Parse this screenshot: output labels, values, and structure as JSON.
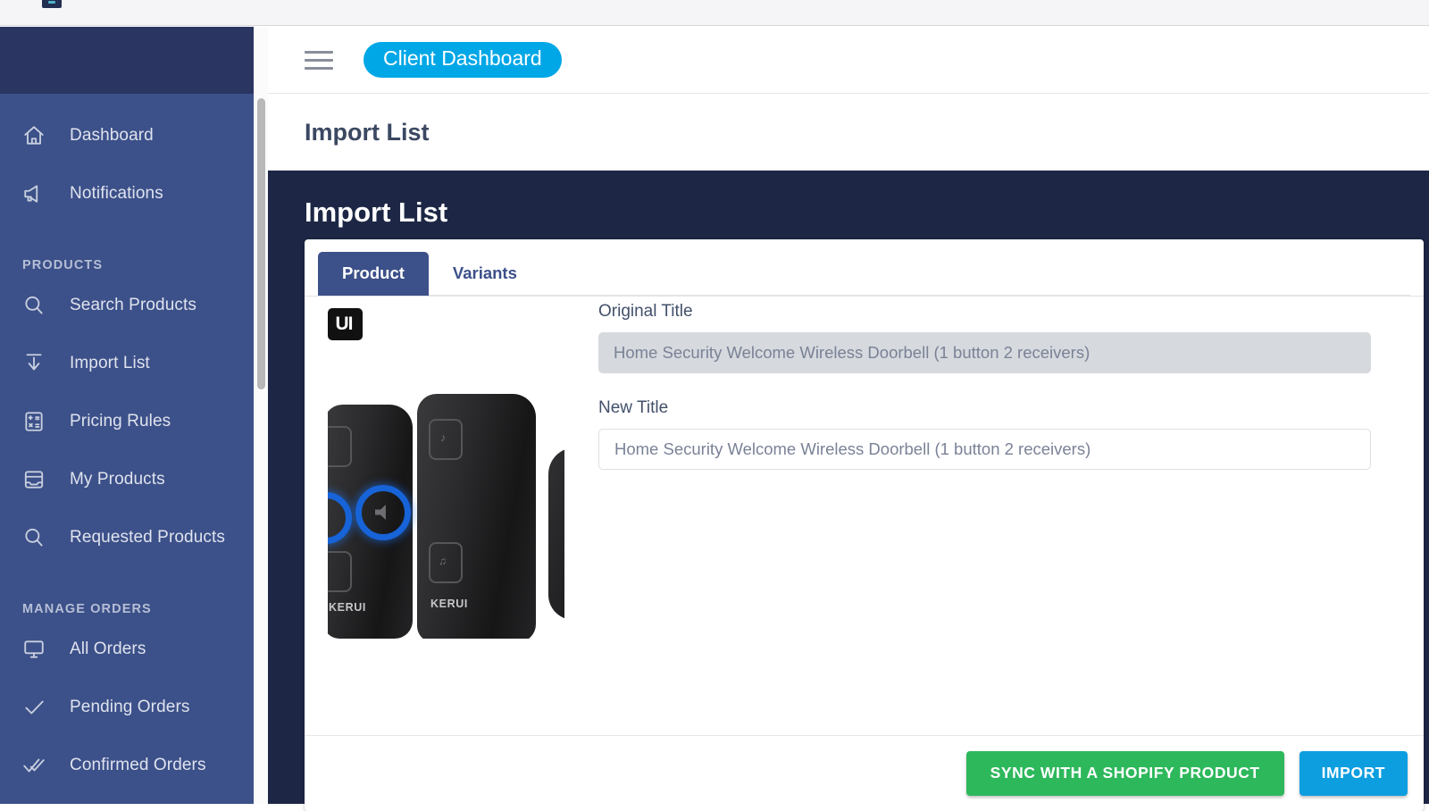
{
  "browser": {
    "tab_text": "",
    "right_text": ""
  },
  "topbar": {
    "menu_icon": "hamburger-icon",
    "client_badge": "Client Dashboard"
  },
  "page": {
    "title": "Import List",
    "heading": "Import List"
  },
  "sidebar": {
    "items": [
      {
        "label": "Dashboard",
        "icon": "home-icon"
      },
      {
        "label": "Notifications",
        "icon": "megaphone-icon"
      }
    ],
    "sections": [
      {
        "title": "PRODUCTS",
        "items": [
          {
            "label": "Search Products",
            "icon": "search-icon"
          },
          {
            "label": "Import List",
            "icon": "download-icon"
          },
          {
            "label": "Pricing Rules",
            "icon": "calculator-icon"
          },
          {
            "label": "My Products",
            "icon": "inbox-icon"
          },
          {
            "label": "Requested Products",
            "icon": "search-icon"
          }
        ]
      },
      {
        "title": "MANAGE ORDERS",
        "items": [
          {
            "label": "All Orders",
            "icon": "monitor-icon"
          },
          {
            "label": "Pending Orders",
            "icon": "check-icon"
          },
          {
            "label": "Confirmed Orders",
            "icon": "double-check-icon"
          }
        ]
      }
    ]
  },
  "card": {
    "tabs": [
      {
        "label": "Product",
        "active": true
      },
      {
        "label": "Variants",
        "active": false
      }
    ],
    "product": {
      "image_watermark": "UI",
      "image_brand": "KERUI",
      "image_alt": "wireless-doorbell-product-image"
    },
    "fields": {
      "original_title_label": "Original Title",
      "original_title_value": "Home Security Welcome Wireless Doorbell (1 button 2 receivers)",
      "new_title_label": "New Title",
      "new_title_placeholder": "Home Security Welcome Wireless Doorbell (1 button 2 receivers)"
    },
    "footer": {
      "sync_label": "SYNC WITH A SHOPIFY PRODUCT",
      "import_label": "IMPORT"
    }
  },
  "colors": {
    "sidebar": "#3c5089",
    "sidebar_head": "#2b3562",
    "content_dark": "#1d2745",
    "accent_blue": "#00a7e7",
    "sync_green": "#2eb85c",
    "import_blue": "#0d9ee0"
  }
}
